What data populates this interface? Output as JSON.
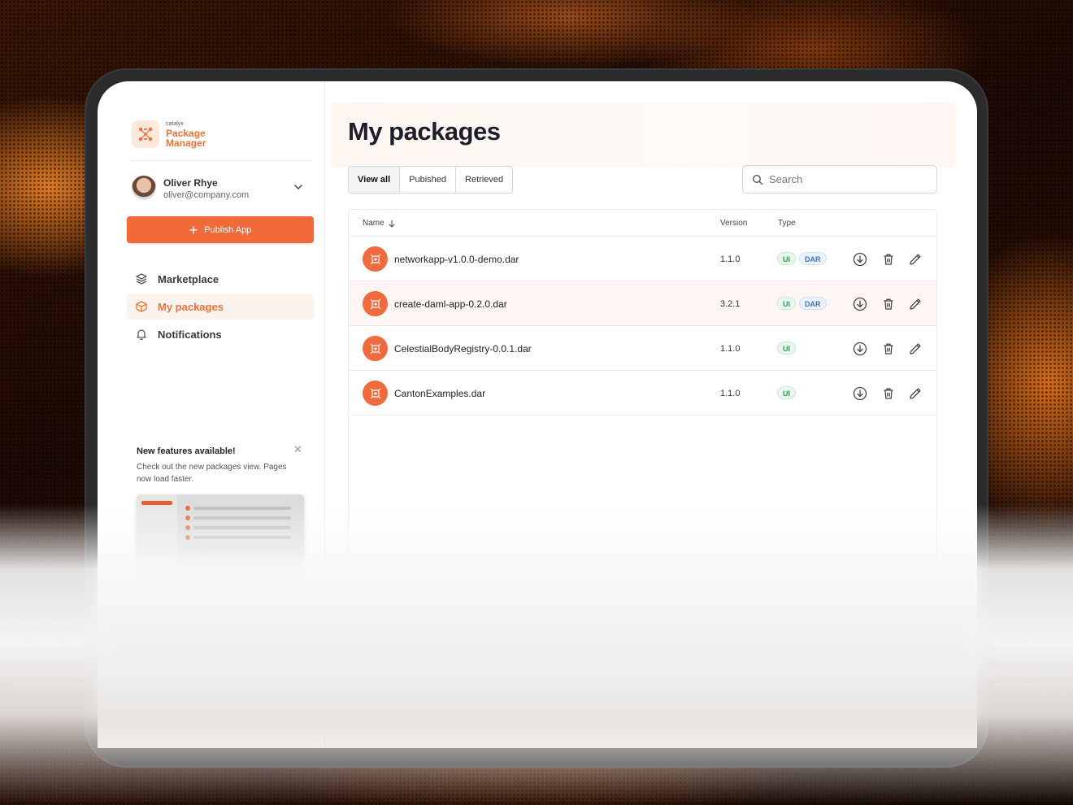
{
  "brand": {
    "small": "catalyx",
    "name": "Package Manager"
  },
  "user": {
    "name": "Oliver Rhye",
    "email": "oliver@company.com"
  },
  "sidebar": {
    "publish_label": "Publish App",
    "items": [
      {
        "label": "Marketplace",
        "icon": "layers-icon",
        "active": false
      },
      {
        "label": "My packages",
        "icon": "cube-icon",
        "active": true
      },
      {
        "label": "Notifications",
        "icon": "bell-icon",
        "active": false
      }
    ]
  },
  "promo": {
    "title": "New features available!",
    "text": "Check out the new packages view. Pages now load faster."
  },
  "main": {
    "title": "My packages",
    "tabs": [
      {
        "label": "View all",
        "active": true
      },
      {
        "label": "Pubished",
        "active": false
      },
      {
        "label": "Retrieved",
        "active": false
      }
    ],
    "search": {
      "placeholder": "Search",
      "value": ""
    },
    "columns": {
      "name": "Name",
      "version": "Version",
      "type": "Type"
    },
    "rows": [
      {
        "name": "networkapp-v1.0.0-demo.dar",
        "version": "1.1.0",
        "types": [
          "UI",
          "DAR"
        ]
      },
      {
        "name": "create-daml-app-0.2.0.dar",
        "version": "3.2.1",
        "types": [
          "UI",
          "DAR"
        ]
      },
      {
        "name": "CelestialBodyRegistry-0.0.1.dar",
        "version": "1.1.0",
        "types": [
          "UI"
        ]
      },
      {
        "name": "CantonExamples.dar",
        "version": "1.1.0",
        "types": [
          "UI"
        ]
      }
    ]
  },
  "colors": {
    "accent": "#f26a3a",
    "ui_badge": "#3a9a5a",
    "dar_badge": "#3f74b6"
  }
}
